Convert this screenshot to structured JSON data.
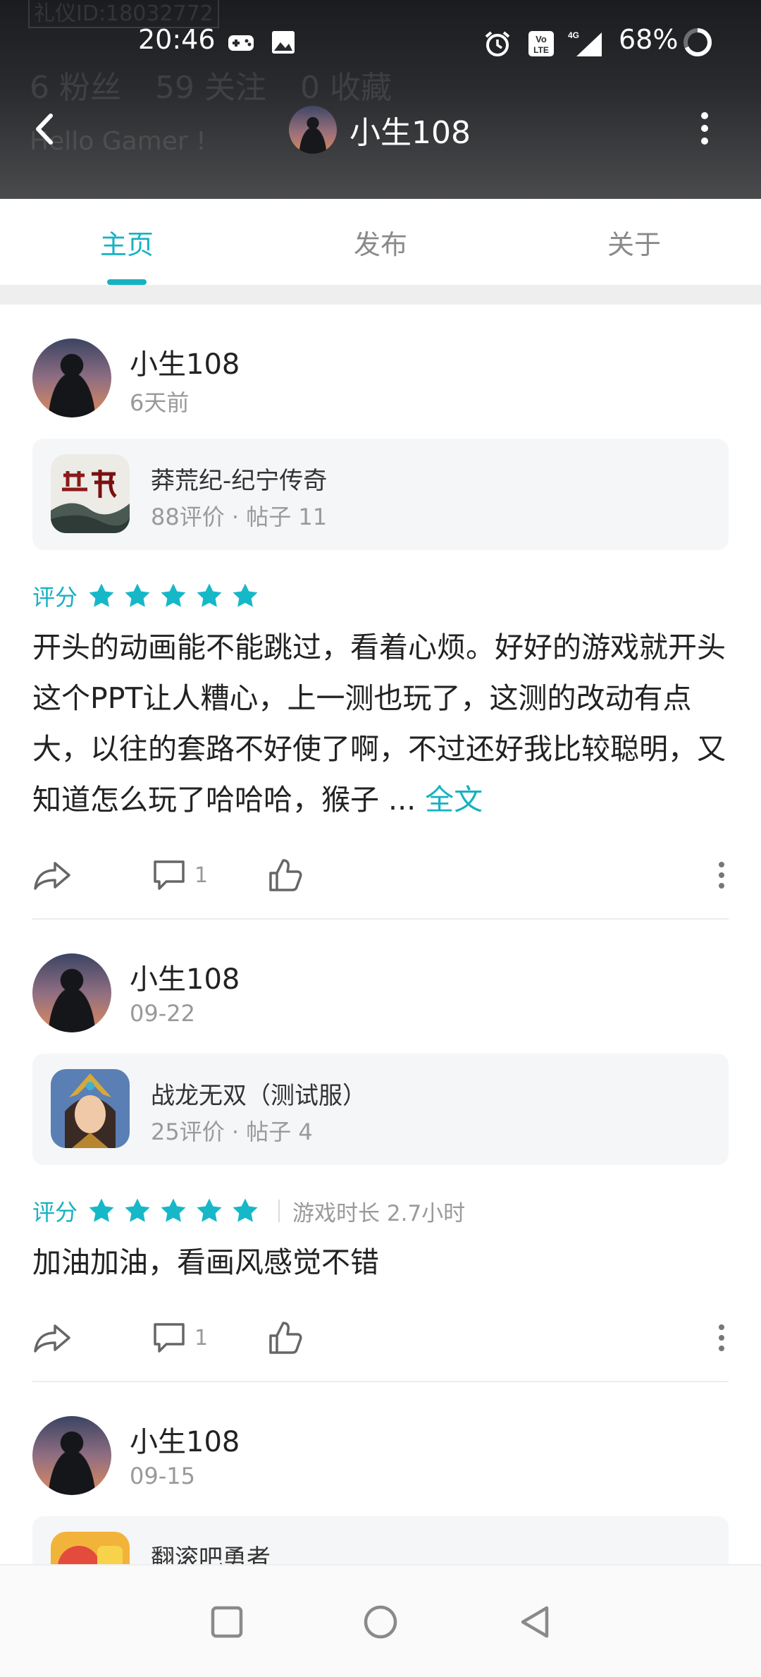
{
  "header": {
    "bg_id_text": "礼仪ID:18032772",
    "bg_stats": [
      "6 粉丝",
      "59 关注",
      "0 收藏"
    ],
    "bg_greeting": "Hello Gamer !",
    "title": "小生108"
  },
  "status_bar": {
    "time": "20:46",
    "network": "4G",
    "battery": "68%",
    "icons": [
      "gamepad-icon",
      "image-icon",
      "alarm-icon",
      "volte-icon",
      "signal-icon",
      "battery-ring-icon"
    ]
  },
  "tabs": [
    {
      "label": "主页",
      "active": true
    },
    {
      "label": "发布",
      "active": false
    },
    {
      "label": "关于",
      "active": false
    }
  ],
  "colors": {
    "accent": "#16b2c2",
    "star": "#16b8c8"
  },
  "posts": [
    {
      "author": "小生108",
      "time": "6天前",
      "game": {
        "name": "莽荒纪-纪宁传奇",
        "meta": "88评价 · 帖子 11"
      },
      "rating_label": "评分",
      "rating": 5,
      "content": "开头的动画能不能跳过，看着心烦。好好的游戏就开头这个PPT让人糟心，上一测也玩了，这测的改动有点大，以往的套路不好使了啊，不过还好我比较聪明，又知道怎么玩了哈哈哈，猴子 ... ",
      "more_label": "全文",
      "comments": "1"
    },
    {
      "author": "小生108",
      "time": "09-22",
      "game": {
        "name": "战龙无双（测试服）",
        "meta": "25评价 · 帖子 4"
      },
      "rating_label": "评分",
      "rating": 5,
      "playtime": "游戏时长 2.7小时",
      "content": "加油加油，看画风感觉不错",
      "comments": "1"
    },
    {
      "author": "小生108",
      "time": "09-15",
      "game": {
        "name": "翻滚吧勇者",
        "meta": ""
      }
    }
  ]
}
